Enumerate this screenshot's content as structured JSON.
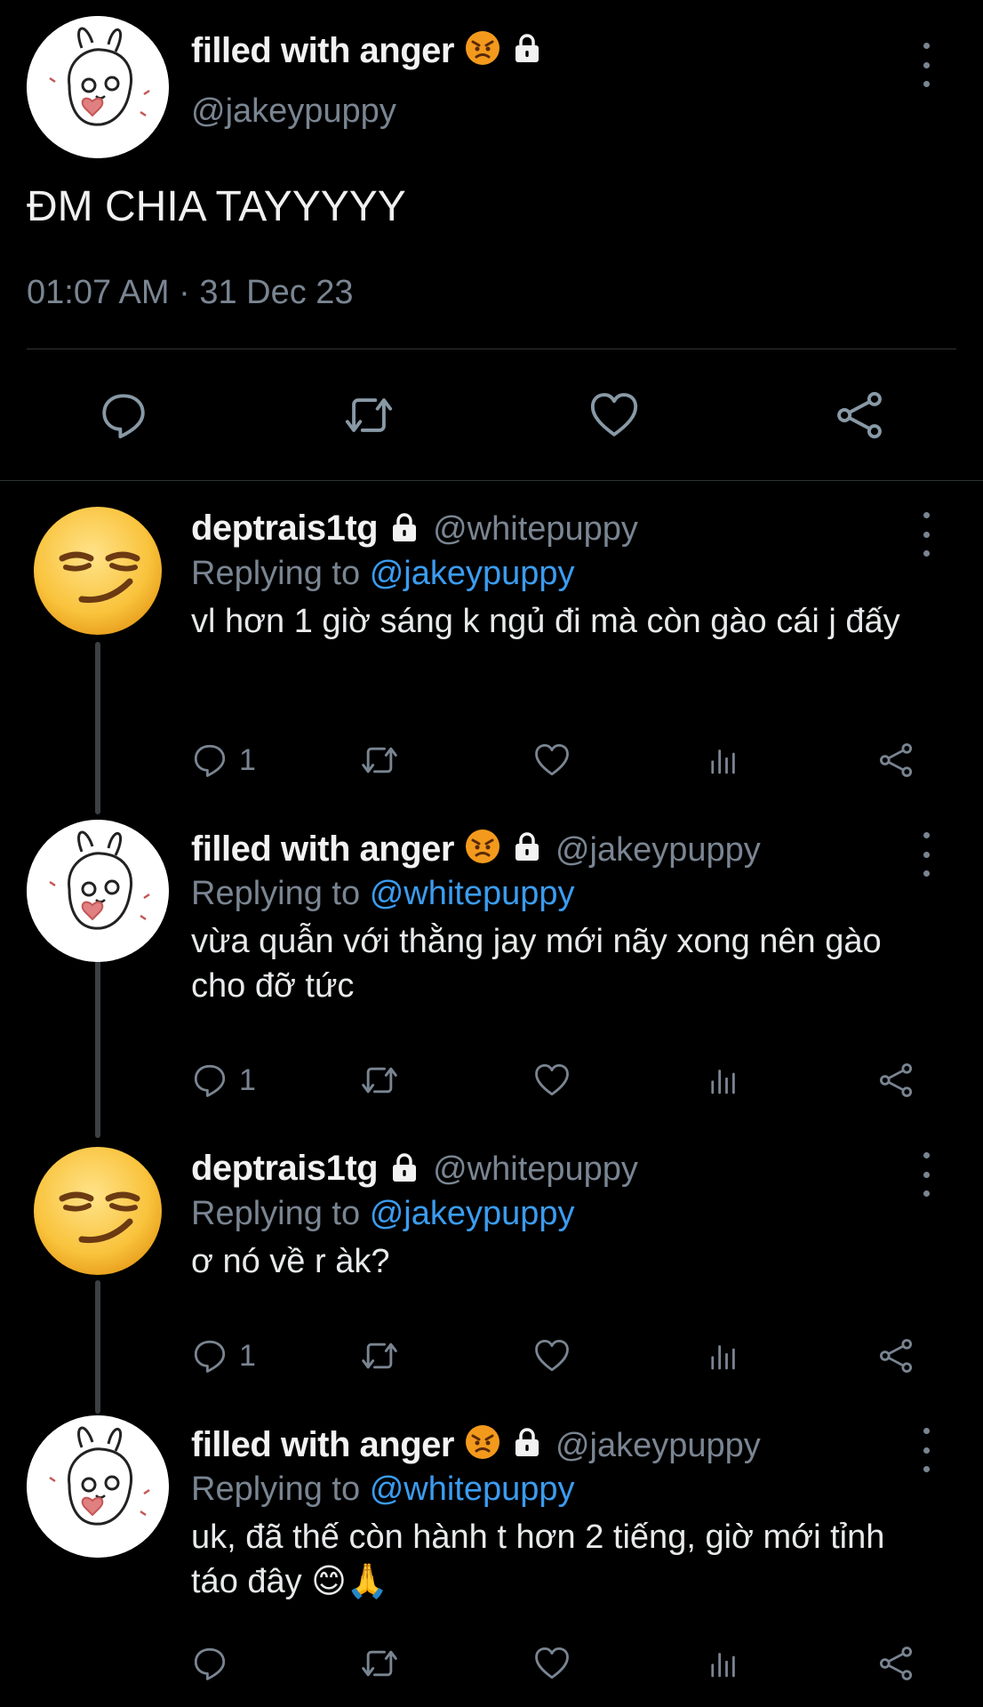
{
  "main_tweet": {
    "display_name": "filled with anger",
    "handle": "@jakeypuppy",
    "text": "ĐM CHIA TAYYYYY",
    "timestamp": "01:07 AM · 31 Dec 23",
    "badges": [
      "angry-emoji-icon",
      "lock-icon"
    ]
  },
  "replies": [
    {
      "display_name": "deptrais1tg",
      "handle": "@whitepuppy",
      "replying_label": "Replying to",
      "replying_to": "@jakeypuppy",
      "text": "vl hơn 1 giờ sáng k ngủ đi mà còn gào cái j đấy",
      "reply_count": "1",
      "avatar": "smirk-emoji"
    },
    {
      "display_name": "filled with anger",
      "handle": "@jakeypuppy",
      "replying_label": "Replying to",
      "replying_to": "@whitepuppy",
      "text": "vừa quẫn với thằng jay mới nãy xong nên gào cho đỡ tức",
      "reply_count": "1",
      "avatar": "bunny-drawing"
    },
    {
      "display_name": "deptrais1tg",
      "handle": "@whitepuppy",
      "replying_label": "Replying to",
      "replying_to": "@jakeypuppy",
      "text": "ơ nó về r àk?",
      "reply_count": "1",
      "avatar": "smirk-emoji"
    },
    {
      "display_name": "filled with anger",
      "handle": "@jakeypuppy",
      "replying_label": "Replying to",
      "replying_to": "@whitepuppy",
      "text": "uk, đã thế còn hành t hơn 2 tiếng, giờ mới tỉnh táo đây 😊🙏",
      "reply_count": "",
      "avatar": "bunny-drawing"
    }
  ],
  "colors": {
    "background": "#000000",
    "text": "#e7e9ea",
    "muted": "#7a8592",
    "mention": "#3b9cf0",
    "divider": "#2f3336"
  }
}
